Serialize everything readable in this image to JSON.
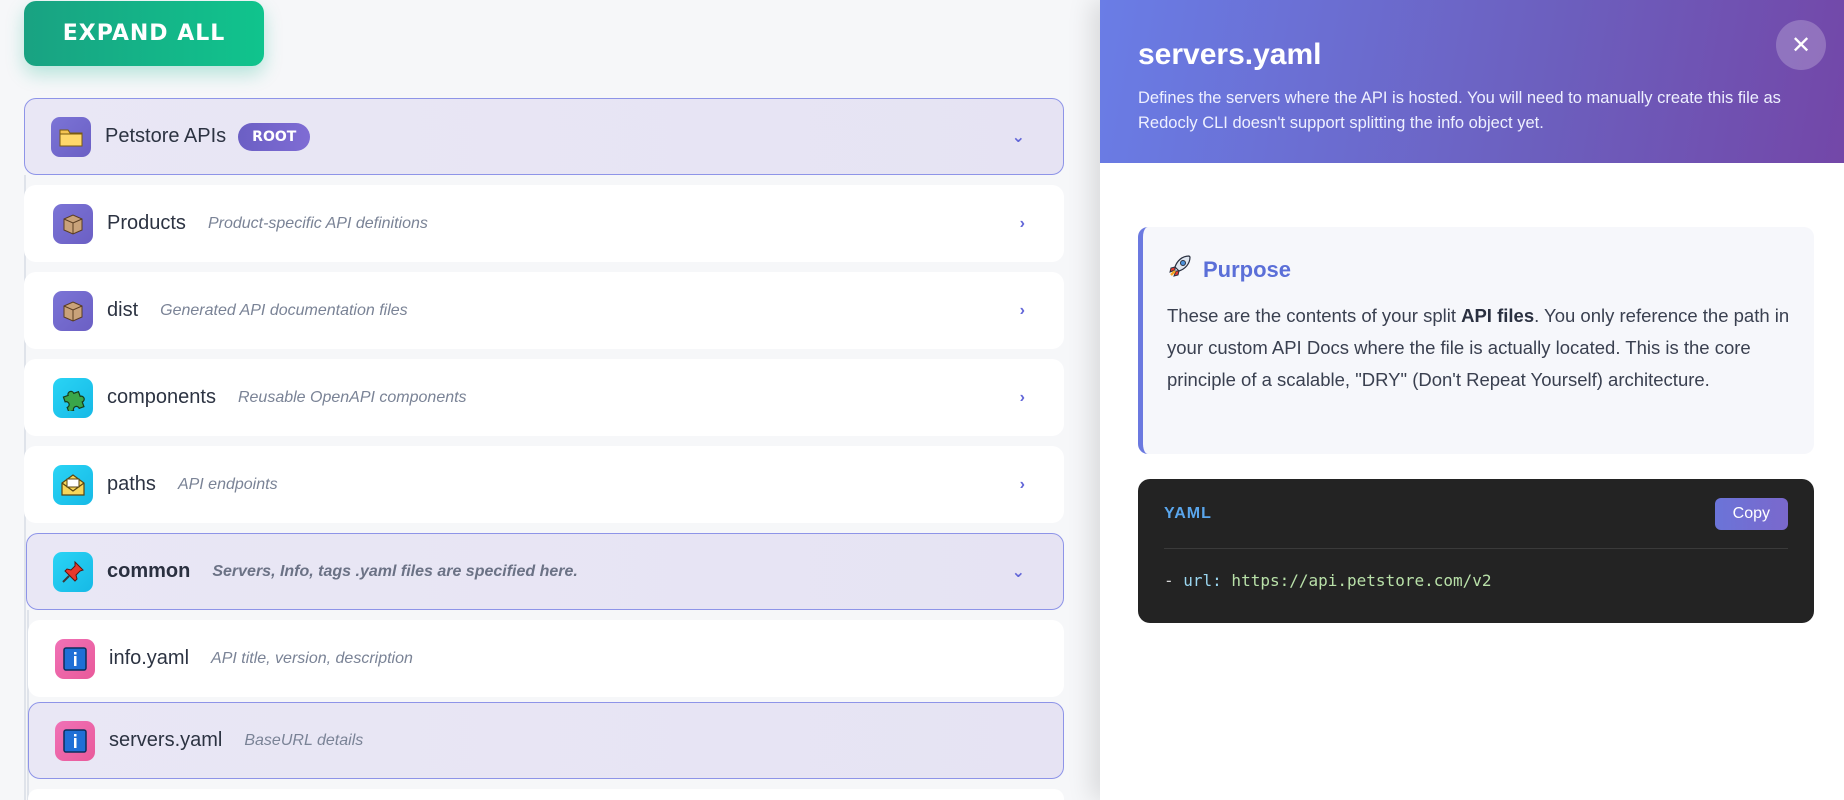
{
  "toolbar": {
    "expand_all_label": "EXPAND ALL"
  },
  "tree": {
    "root": {
      "name": "Petstore APIs",
      "badge": "ROOT",
      "icon": "folder-icon"
    },
    "items": [
      {
        "name": "Products",
        "desc": "Product-specific API definitions",
        "icon": "package-icon"
      },
      {
        "name": "dist",
        "desc": "Generated API documentation files",
        "icon": "package-icon"
      },
      {
        "name": "components",
        "desc": "Reusable OpenAPI components",
        "icon": "puzzle-icon"
      },
      {
        "name": "paths",
        "desc": "API endpoints",
        "icon": "envelope-icon"
      },
      {
        "name": "common",
        "desc": "Servers, Info, tags .yaml files are specified here.",
        "icon": "pushpin-icon"
      },
      {
        "name": "info.yaml",
        "desc": "API title, version, description",
        "icon": "info-icon"
      },
      {
        "name": "servers.yaml",
        "desc": "BaseURL details",
        "icon": "info-icon"
      }
    ]
  },
  "detail": {
    "title": "servers.yaml",
    "description": "Defines the servers where the API is hosted. You will need to manually create this file as Redocly CLI doesn't support splitting the info object yet.",
    "purpose": {
      "heading": "Purpose",
      "text_before": "These are the contents of your split ",
      "text_bold": "API files",
      "text_after": ". You only reference the path in your custom API Docs where the file is actually located. This is the core principle of a scalable, \"DRY\" (Don't Repeat Yourself) architecture."
    },
    "code": {
      "language": "YAML",
      "copy_label": "Copy",
      "dash": "- ",
      "key": "url:",
      "value": " https://api.petstore.com/v2"
    }
  },
  "colors": {
    "accent": "#6b79e0",
    "expand_button": "#10c48d",
    "header_gradient_start": "#6a7de6",
    "header_gradient_end": "#7347a8",
    "code_bg": "#232323"
  }
}
